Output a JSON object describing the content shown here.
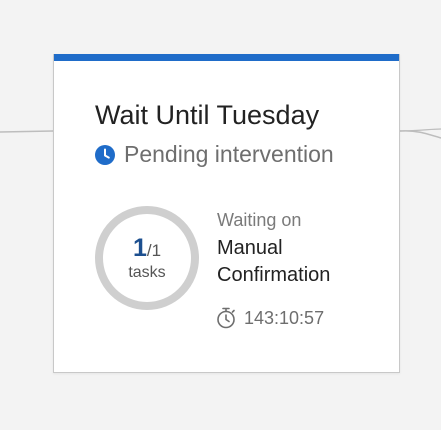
{
  "stage": {
    "title": "Wait Until Tuesday",
    "status": "Pending intervention",
    "status_icon": "clock-icon"
  },
  "progress": {
    "completed": "1",
    "separator": "/",
    "total": "1",
    "unit": "tasks",
    "fraction": 1.0
  },
  "waiting": {
    "label": "Waiting on",
    "target": "Manual Confirmation"
  },
  "timer": {
    "icon": "stopwatch-icon",
    "value": "143:10:57"
  },
  "colors": {
    "accent": "#1f6cc9",
    "ring_track": "#cfcfcf",
    "count": "#1c4f8f"
  }
}
